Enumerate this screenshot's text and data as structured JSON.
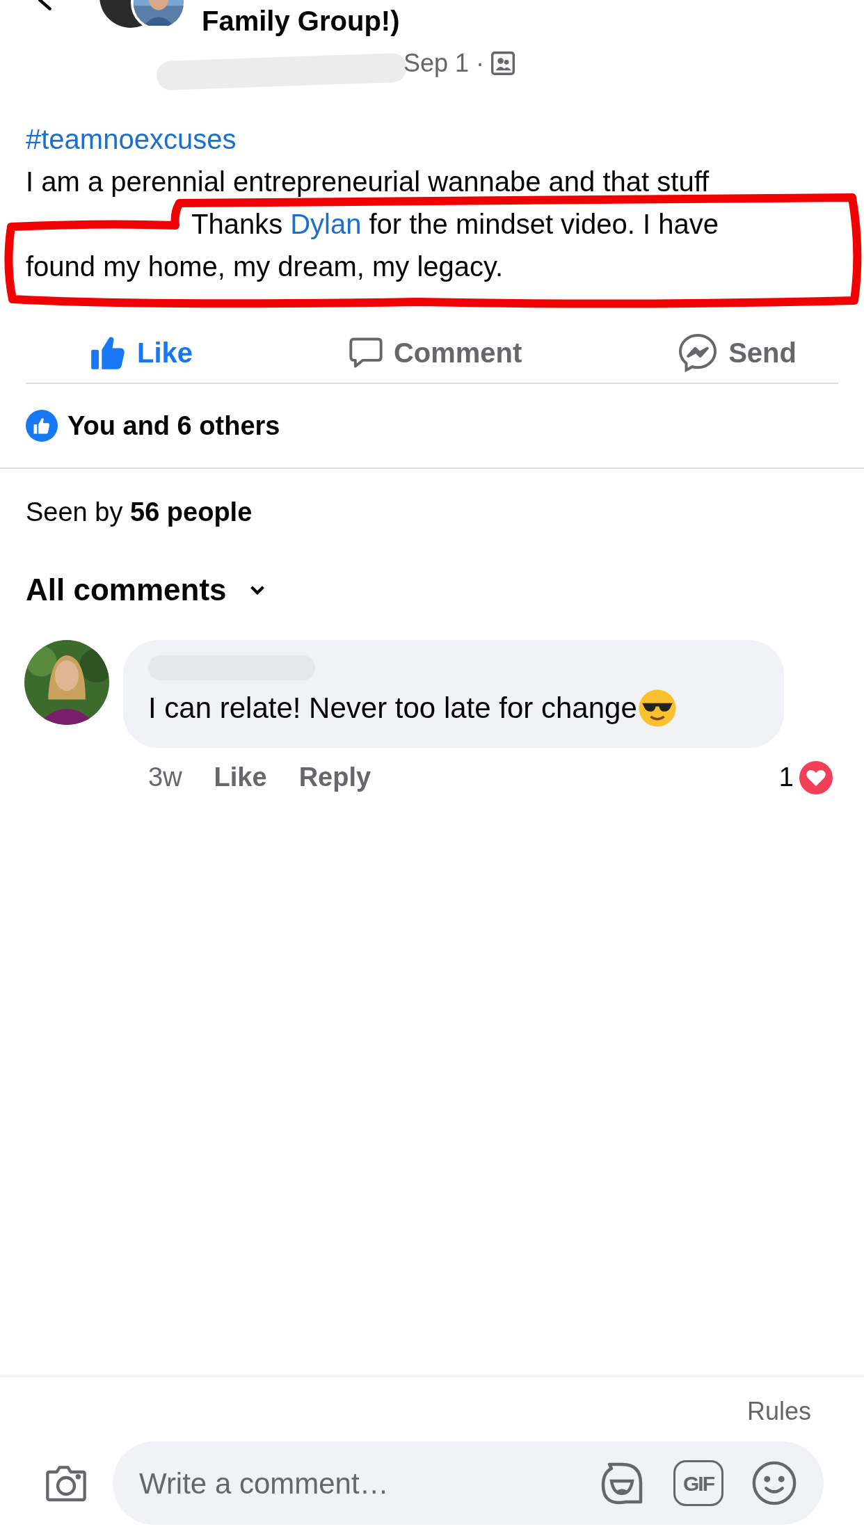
{
  "header": {
    "group_title": "Family Group!)",
    "date": "Sep 1 ·"
  },
  "post": {
    "hashtag": "#teamnoexcuses",
    "line_1": "I am a perennial entrepreneurial wannabe and that stuff",
    "line_2": {
      "before": "Thanks",
      "mention": "Dylan",
      "after": "for the mindset video. I have"
    },
    "line_3": "found my home, my dream, my legacy.",
    "highlighted": true
  },
  "actions": [
    {
      "kind": "like",
      "label": "Like",
      "selected": true
    },
    {
      "kind": "comment",
      "label": "Comment",
      "selected": false
    },
    {
      "kind": "send",
      "label": "Send",
      "selected": false
    }
  ],
  "reactions": {
    "text": "You and 6 others"
  },
  "seen_by": "Seen by **56 people**",
  "comments_filter": "All comments",
  "comments": [
    {
      "text": "I can relate! Never too late for change",
      "time": "3w",
      "like": "Like",
      "reply": "Reply",
      "reaction_count": "1"
    }
  ],
  "composer": {
    "rules": "Rules",
    "placeholder": "Write a comment…",
    "gif": "GIF"
  }
}
